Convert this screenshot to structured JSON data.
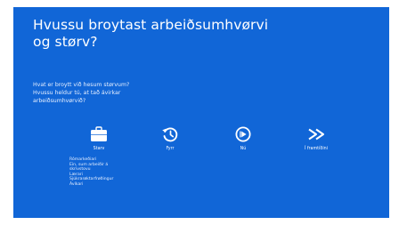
{
  "slide": {
    "title_lines": [
      "Hvussu broytast arbeiðsumhvørvi",
      "og størv?"
    ],
    "intro_lines": [
      "Hvat er broytt við hesum størvum?",
      "Hvussu heldur tú, at tað ávirkar",
      "arbeiðsumhvørvið?"
    ],
    "accent_color": "#1166d7",
    "columns": [
      {
        "icon": "briefcase-icon",
        "label": "Starv"
      },
      {
        "icon": "history-icon",
        "label": "Fyrr"
      },
      {
        "icon": "play-icon",
        "label": "Nú"
      },
      {
        "icon": "fast-forward-icon",
        "label": "Í framtíðini"
      }
    ],
    "details": [
      "Rómarkeðiari",
      "Ein, sum arbeiðir á",
      "skrivstovu",
      "Lærari",
      "Sjúkrarøktarfrøðingur",
      "Ávíkari"
    ]
  }
}
